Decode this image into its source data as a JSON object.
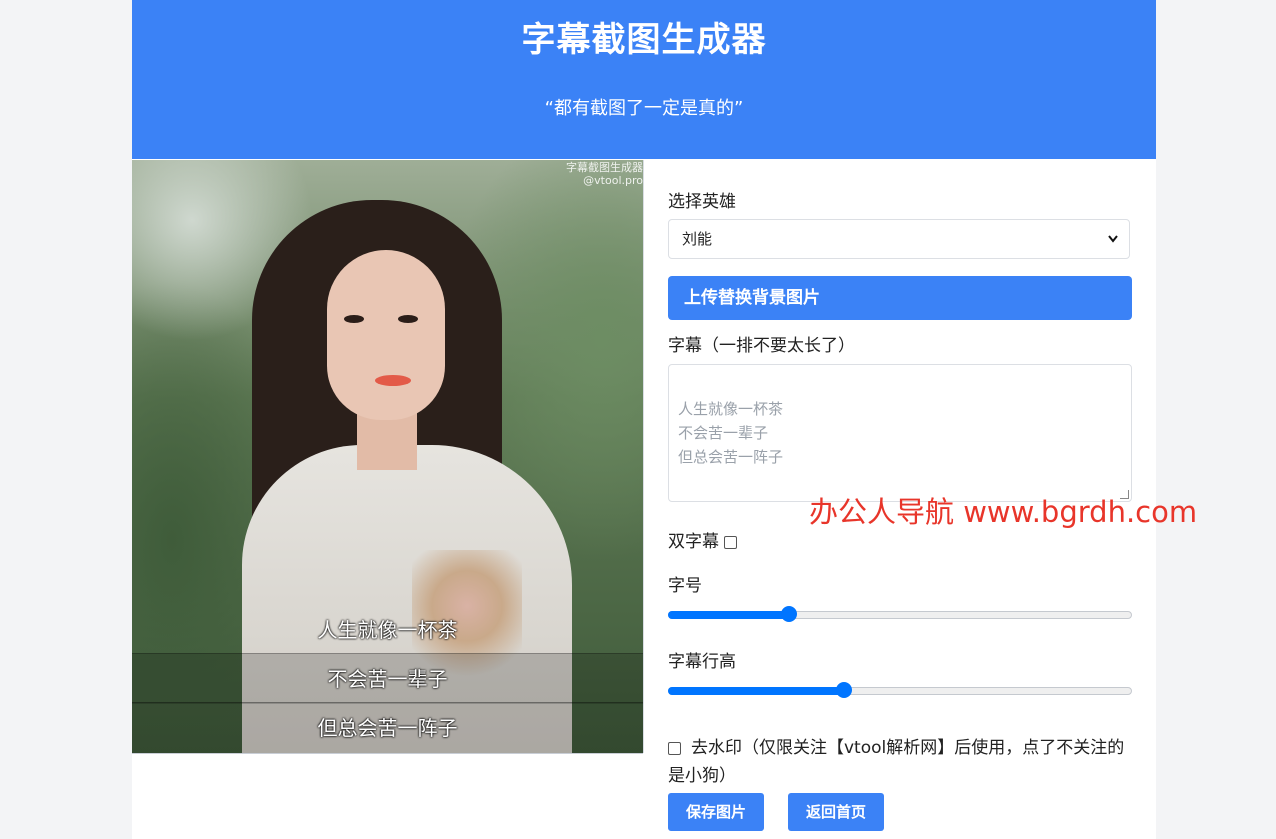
{
  "header": {
    "title": "字幕截图生成器",
    "subtitle": "“都有截图了一定是真的”"
  },
  "preview": {
    "watermark_line1": "字幕截图生成器",
    "watermark_line2": "@vtool.pro",
    "subtitles": [
      "人生就像一杯茶",
      "不会苦一辈子",
      "但总会苦一阵子"
    ]
  },
  "form": {
    "hero_label": "选择英雄",
    "hero_value": "刘能",
    "upload_label": "上传替换背景图片",
    "subtitle_label": "字幕（一排不要太长了）",
    "subtitle_placeholder": "人生就像一杯茶\n不会苦一辈子\n但总会苦一阵子",
    "dual_label": "双字幕",
    "dual_checked": false,
    "font_size_label": "字号",
    "font_size_value_fraction": 0.26,
    "line_height_label": "字幕行高",
    "line_height_value_fraction": 0.38,
    "remove_wm_label": "去水印（仅限关注【vtool解析网】后使用，点了不关注的是小狗）",
    "remove_wm_checked": false,
    "save_label": "保存图片",
    "home_label": "返回首页"
  },
  "overlay": {
    "text": "办公人导航  www.bgrdh.com"
  },
  "colors": {
    "primary": "#3b82f6",
    "slider": "#0075ff",
    "overlay_text": "#e8352a"
  }
}
